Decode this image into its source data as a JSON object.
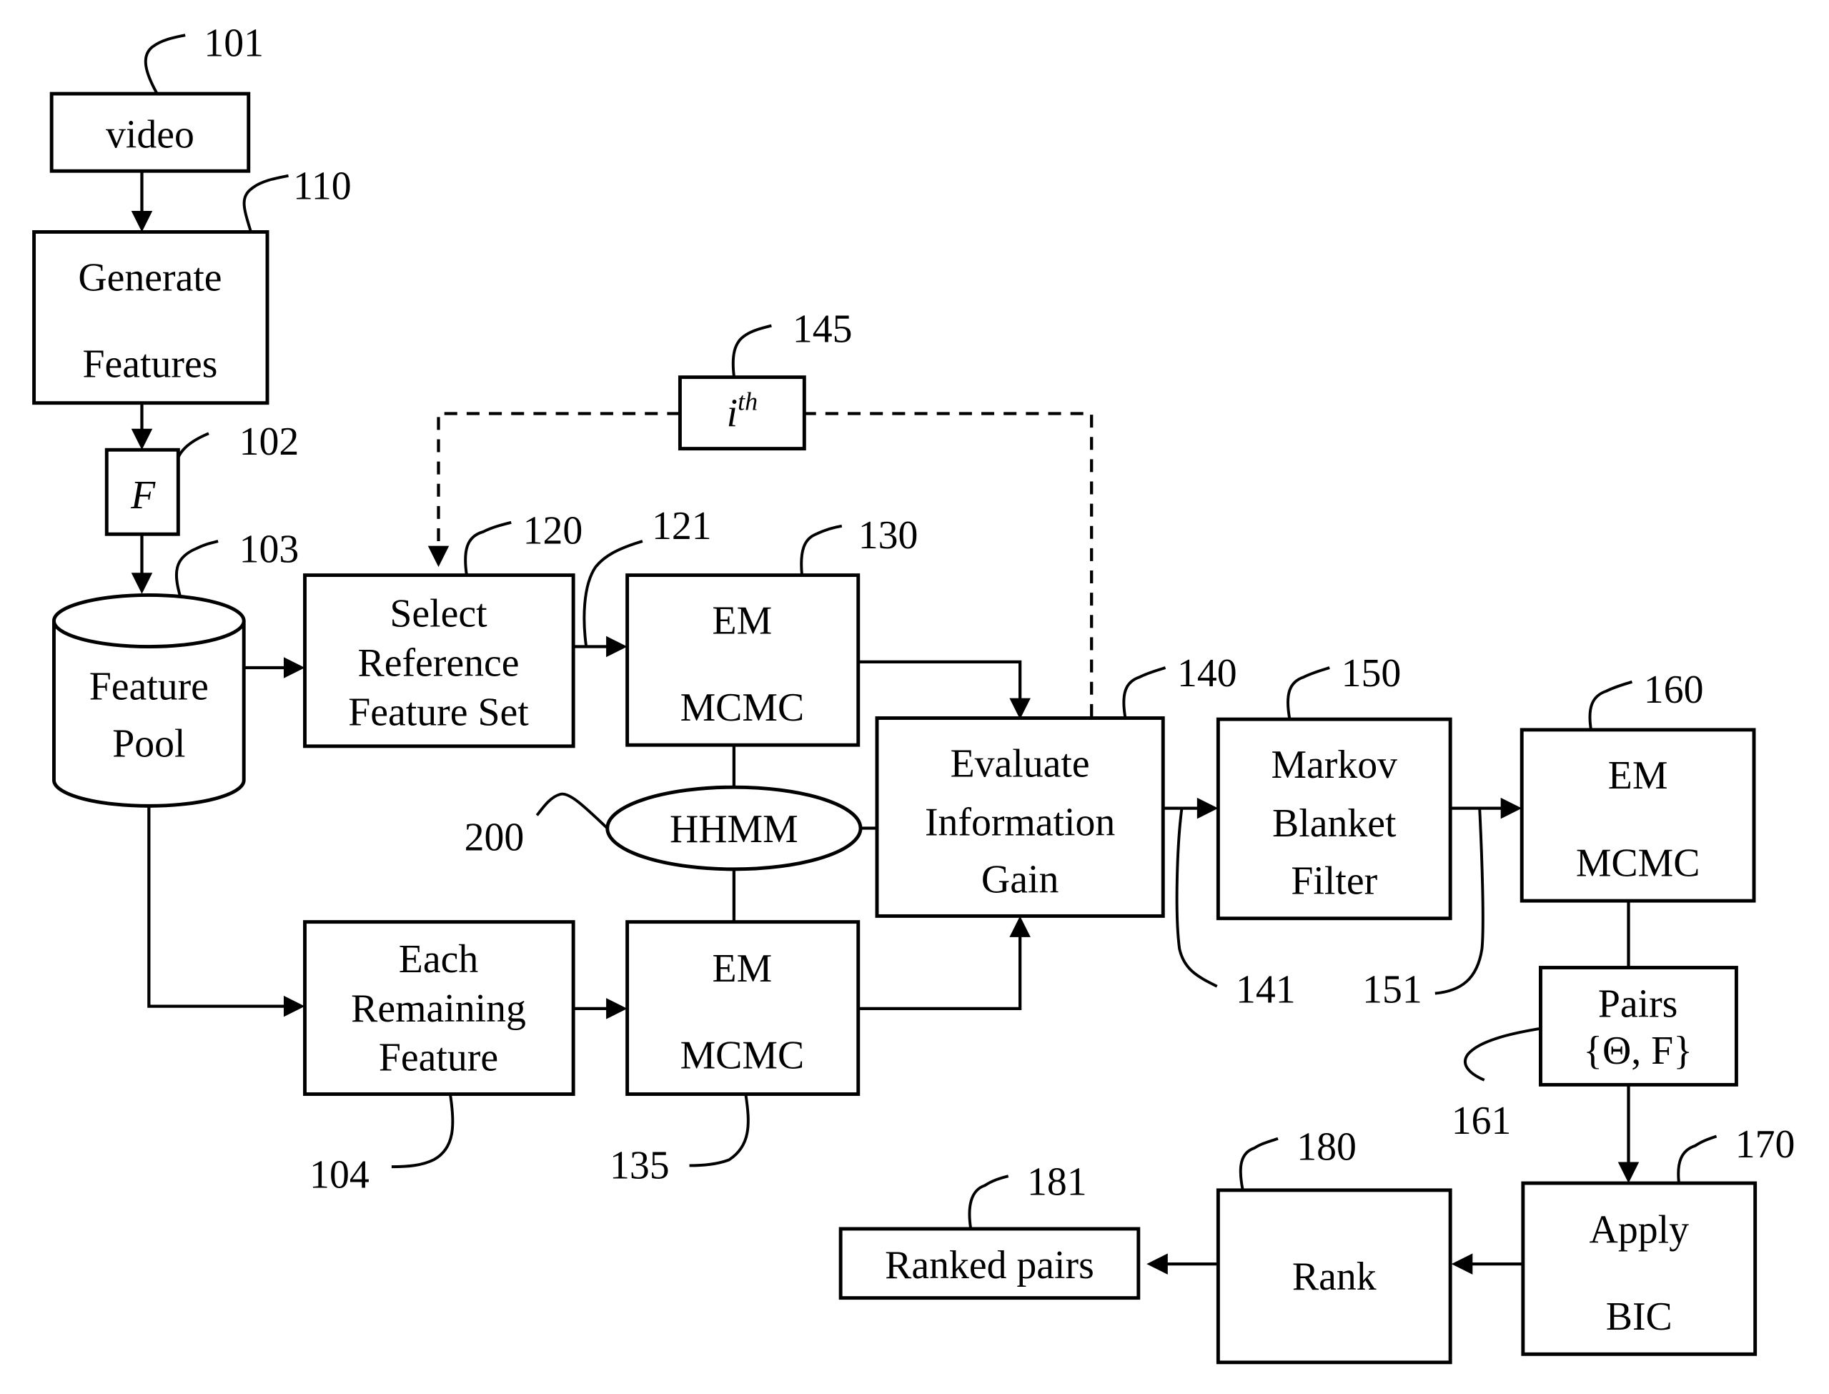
{
  "diagram": {
    "nodes": {
      "video": {
        "lines": [
          "video"
        ],
        "ref": "101"
      },
      "generate": {
        "lines": [
          "Generate",
          "Features"
        ],
        "ref": "110"
      },
      "f": {
        "lines": [
          "F"
        ],
        "ref": "102"
      },
      "pool": {
        "lines": [
          "Feature",
          "Pool"
        ],
        "ref": "103"
      },
      "select": {
        "lines": [
          "Select",
          "Reference",
          "Feature Set"
        ],
        "ref": "120"
      },
      "remaining": {
        "lines": [
          "Each",
          "Remaining",
          "Feature"
        ],
        "ref": "104"
      },
      "em1": {
        "lines": [
          "EM",
          "MCMC"
        ],
        "ref": "130"
      },
      "em2": {
        "lines": [
          "EM",
          "MCMC"
        ],
        "ref": "135"
      },
      "hhmm": {
        "lines": [
          "HHMM"
        ],
        "ref": "200"
      },
      "ith": {
        "base": "i",
        "sup": "th",
        "ref": "145"
      },
      "evaluate": {
        "lines": [
          "Evaluate",
          "Information",
          "Gain"
        ],
        "ref": "140"
      },
      "markov": {
        "lines": [
          "Markov",
          "Blanket",
          "Filter"
        ],
        "ref": "150"
      },
      "em3": {
        "lines": [
          "EM",
          "MCMC"
        ],
        "ref": "160"
      },
      "pairs": {
        "lines": [
          "Pairs",
          "{Θ, F}"
        ],
        "ref": "161"
      },
      "bic": {
        "lines": [
          "Apply",
          "BIC"
        ],
        "ref": "170"
      },
      "rank": {
        "lines": [
          "Rank"
        ],
        "ref": "180"
      },
      "ranked": {
        "lines": [
          "Ranked pairs"
        ],
        "ref": "181"
      }
    },
    "edge_refs": {
      "select_to_em": "121",
      "eval_to_markov": "141",
      "markov_to_em3": "151"
    }
  }
}
